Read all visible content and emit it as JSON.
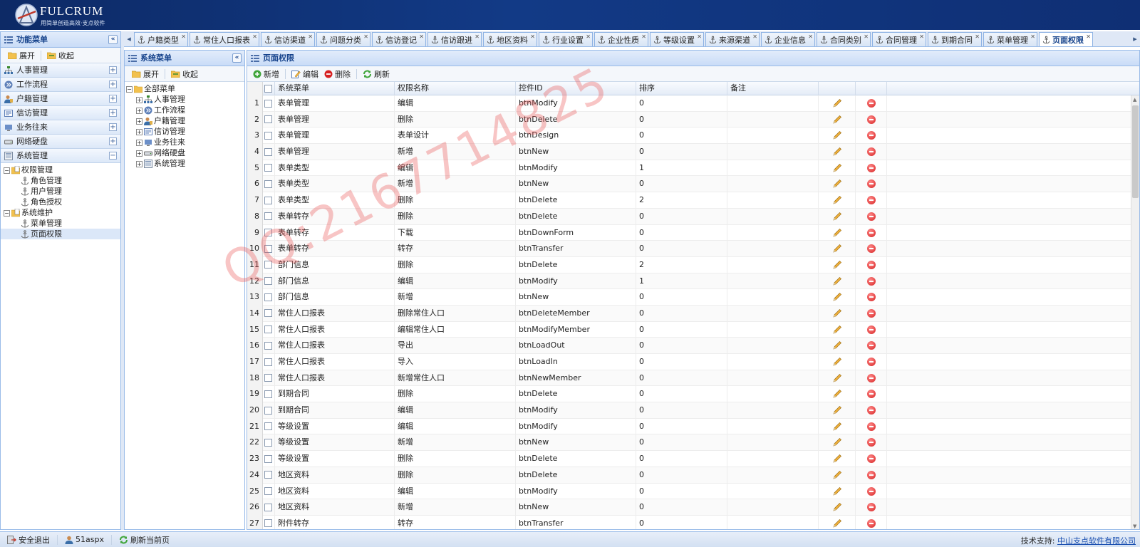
{
  "header": {
    "brand": "FULCRUM",
    "slogan": "用简单创造高效·支点软件"
  },
  "left_panel": {
    "title": "功能菜单",
    "toolbar": {
      "expand": "展开",
      "collapse": "收起"
    },
    "accordion": [
      {
        "label": "人事管理",
        "icon": "org-chart-icon"
      },
      {
        "label": "工作流程",
        "icon": "workflow-icon"
      },
      {
        "label": "户籍管理",
        "icon": "person-icon"
      },
      {
        "label": "信访管理",
        "icon": "form-icon"
      },
      {
        "label": "业务往来",
        "icon": "monitor-icon"
      },
      {
        "label": "网络硬盘",
        "icon": "drive-icon"
      },
      {
        "label": "系统管理",
        "icon": "system-icon",
        "expanded": true
      }
    ],
    "tree": {
      "g1": "权限管理",
      "g1_items": [
        "角色管理",
        "用户管理",
        "角色授权"
      ],
      "g2": "系统维护",
      "g2_items": [
        "菜单管理",
        "页面权限"
      ]
    }
  },
  "tabs": [
    "户籍类型",
    "常住人口报表",
    "信访渠道",
    "问题分类",
    "信访登记",
    "信访跟进",
    "地区资料",
    "行业设置",
    "企业性质",
    "等级设置",
    "来源渠道",
    "企业信息",
    "合同类别",
    "合同管理",
    "到期合同",
    "菜单管理",
    "页面权限"
  ],
  "active_tab": "页面权限",
  "mid_panel": {
    "title": "系统菜单",
    "toolbar": {
      "expand": "展开",
      "collapse": "收起"
    },
    "root": "全部菜单",
    "nodes": [
      "人事管理",
      "工作流程",
      "户籍管理",
      "信访管理",
      "业务往来",
      "网络硬盘",
      "系统管理"
    ]
  },
  "main_panel": {
    "title": "页面权限",
    "toolbar": {
      "add": "新增",
      "edit": "编辑",
      "delete": "删除",
      "refresh": "刷新"
    },
    "columns": [
      "系统菜单",
      "权限名称",
      "控件ID",
      "排序",
      "备注"
    ],
    "rows": [
      [
        "1",
        "表单管理",
        "编辑",
        "btnModify",
        "0"
      ],
      [
        "2",
        "表单管理",
        "删除",
        "btnDelete",
        "0"
      ],
      [
        "3",
        "表单管理",
        "表单设计",
        "btnDesign",
        "0"
      ],
      [
        "4",
        "表单管理",
        "新增",
        "btnNew",
        "0"
      ],
      [
        "5",
        "表单类型",
        "编辑",
        "btnModify",
        "1"
      ],
      [
        "6",
        "表单类型",
        "新增",
        "btnNew",
        "0"
      ],
      [
        "7",
        "表单类型",
        "删除",
        "btnDelete",
        "2"
      ],
      [
        "8",
        "表单转存",
        "删除",
        "btnDelete",
        "0"
      ],
      [
        "9",
        "表单转存",
        "下载",
        "btnDownForm",
        "0"
      ],
      [
        "10",
        "表单转存",
        "转存",
        "btnTransfer",
        "0"
      ],
      [
        "11",
        "部门信息",
        "删除",
        "btnDelete",
        "2"
      ],
      [
        "12",
        "部门信息",
        "编辑",
        "btnModify",
        "1"
      ],
      [
        "13",
        "部门信息",
        "新增",
        "btnNew",
        "0"
      ],
      [
        "14",
        "常住人口报表",
        "删除常住人口",
        "btnDeleteMember",
        "0"
      ],
      [
        "15",
        "常住人口报表",
        "编辑常住人口",
        "btnModifyMember",
        "0"
      ],
      [
        "16",
        "常住人口报表",
        "导出",
        "btnLoadOut",
        "0"
      ],
      [
        "17",
        "常住人口报表",
        "导入",
        "btnLoadIn",
        "0"
      ],
      [
        "18",
        "常住人口报表",
        "新增常住人口",
        "btnNewMember",
        "0"
      ],
      [
        "19",
        "到期合同",
        "删除",
        "btnDelete",
        "0"
      ],
      [
        "20",
        "到期合同",
        "编辑",
        "btnModify",
        "0"
      ],
      [
        "21",
        "等级设置",
        "编辑",
        "btnModify",
        "0"
      ],
      [
        "22",
        "等级设置",
        "新增",
        "btnNew",
        "0"
      ],
      [
        "23",
        "等级设置",
        "删除",
        "btnDelete",
        "0"
      ],
      [
        "24",
        "地区资料",
        "删除",
        "btnDelete",
        "0"
      ],
      [
        "25",
        "地区资料",
        "编辑",
        "btnModify",
        "0"
      ],
      [
        "26",
        "地区资料",
        "新增",
        "btnNew",
        "0"
      ],
      [
        "27",
        "附件转存",
        "转存",
        "btnTransfer",
        "0"
      ]
    ]
  },
  "status": {
    "logout": "安全退出",
    "user": "51aspx",
    "refresh": "刷新当前页",
    "support_label": "技术支持:",
    "support_link": "中山支点软件有限公司"
  },
  "watermark": "QQ:2167714825",
  "colors": {
    "header_bg": "#123a86",
    "panel_border": "#99bbe8",
    "panel_title": "#15428b",
    "delete_red": "#d62121"
  }
}
